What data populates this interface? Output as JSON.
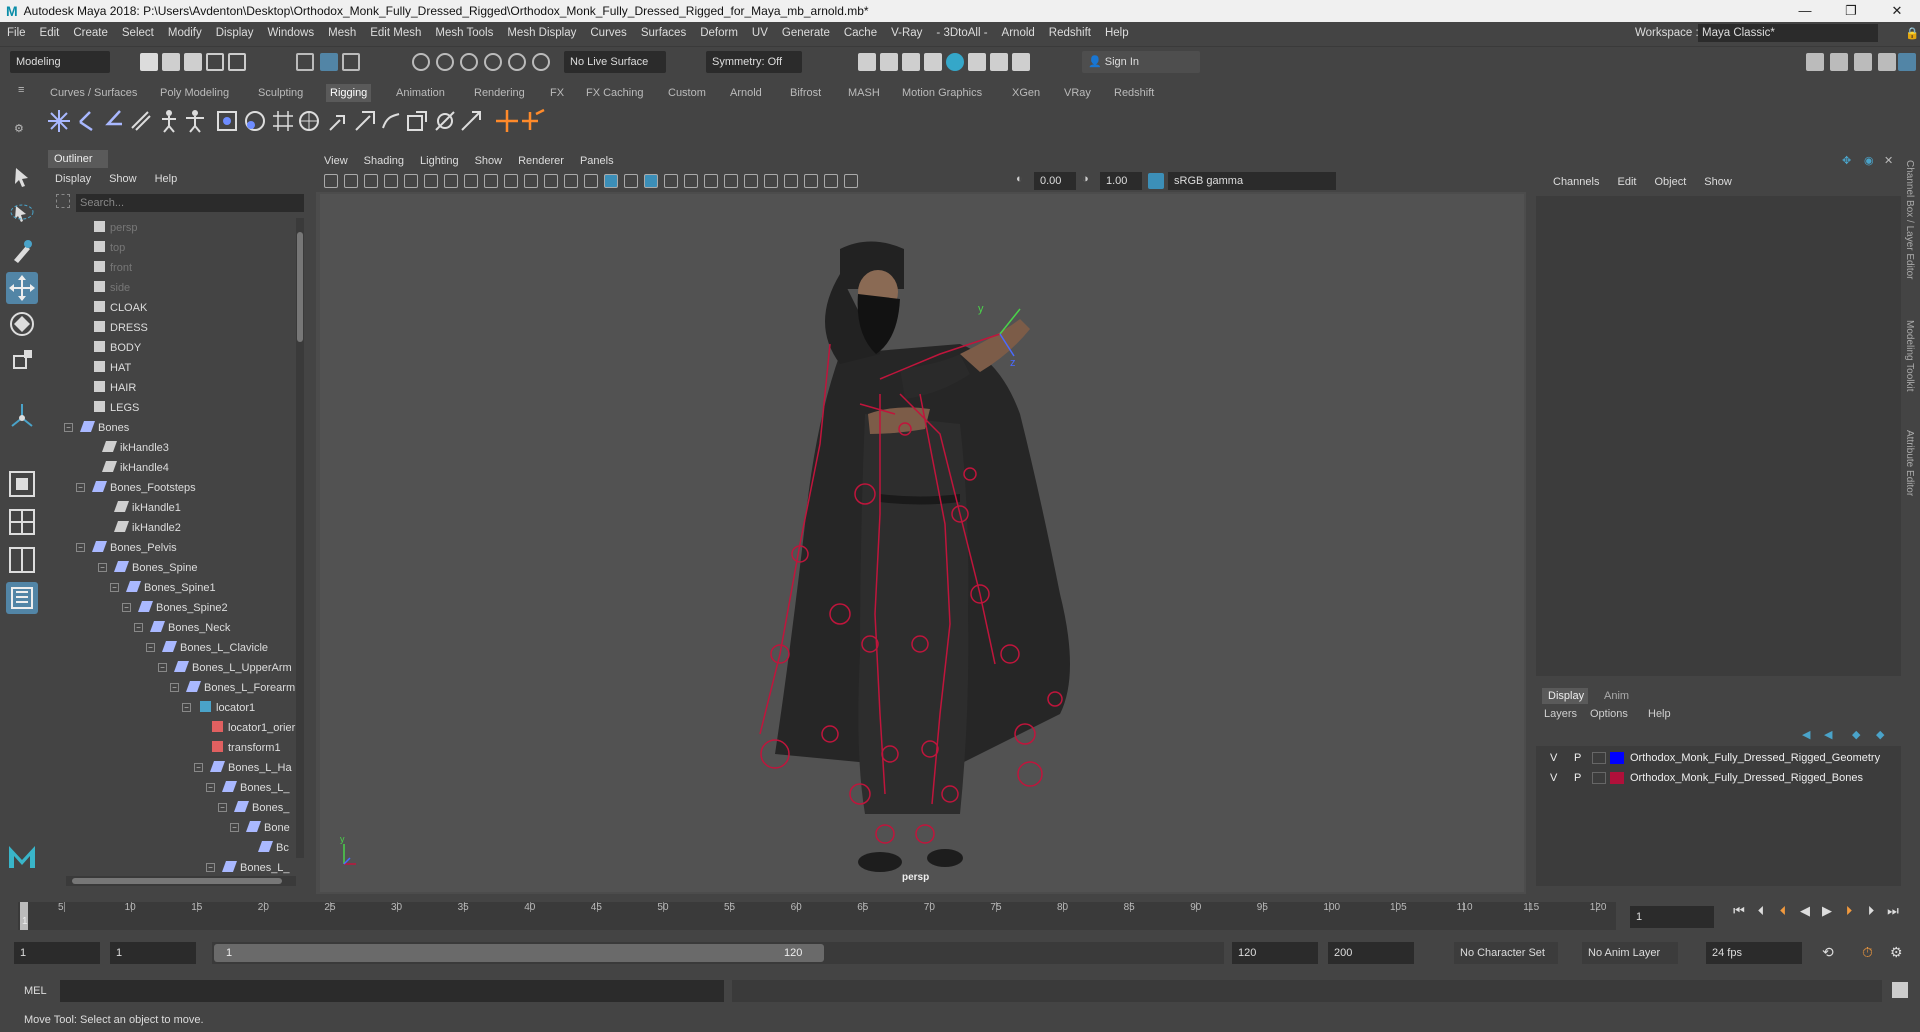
{
  "titlebar": {
    "title": "Autodesk Maya 2018: P:\\Users\\Avdenton\\Desktop\\Orthodox_Monk_Fully_Dressed_Rigged\\Orthodox_Monk_Fully_Dressed_Rigged_for_Maya_mb_arnold.mb*",
    "min": "—",
    "max": "❐",
    "close": "✕"
  },
  "menubar": [
    "File",
    "Edit",
    "Create",
    "Select",
    "Modify",
    "Display",
    "Windows",
    "Mesh",
    "Edit Mesh",
    "Mesh Tools",
    "Mesh Display",
    "Curves",
    "Surfaces",
    "Deform",
    "UV",
    "Generate",
    "Cache",
    "V-Ray",
    "- 3DtoAll -",
    "Arnold",
    "Redshift",
    "Help"
  ],
  "workspace": {
    "label": "Workspace :",
    "value": "Maya Classic*"
  },
  "statusline": {
    "mode": "Modeling",
    "live_surface": "No Live Surface",
    "symmetry": "Symmetry: Off",
    "sign_in": "Sign In"
  },
  "shelf_tabs": [
    "Curves / Surfaces",
    "Poly Modeling",
    "Sculpting",
    "Rigging",
    "Animation",
    "Rendering",
    "FX",
    "FX Caching",
    "Custom",
    "Arnold",
    "Bifrost",
    "MASH",
    "Motion Graphics",
    "XGen",
    "VRay",
    "Redshift"
  ],
  "shelf_active": "Rigging",
  "outliner": {
    "title": "Outliner",
    "menu": [
      "Display",
      "Show",
      "Help"
    ],
    "search_placeholder": "Search...",
    "rows": [
      {
        "label": "persp",
        "icon": "camera-icon",
        "dim": true
      },
      {
        "label": "top",
        "icon": "camera-icon",
        "dim": true
      },
      {
        "label": "front",
        "icon": "camera-icon",
        "dim": true
      },
      {
        "label": "side",
        "icon": "camera-icon",
        "dim": true
      },
      {
        "label": "CLOAK",
        "icon": "mesh-icon"
      },
      {
        "label": "DRESS",
        "icon": "mesh-icon"
      },
      {
        "label": "BODY",
        "icon": "mesh-icon"
      },
      {
        "label": "HAT",
        "icon": "mesh-icon"
      },
      {
        "label": "HAIR",
        "icon": "mesh-icon"
      },
      {
        "label": "LEGS",
        "icon": "mesh-icon"
      },
      {
        "label": "Bones",
        "icon": "joint-icon"
      },
      {
        "label": "ikHandle3",
        "icon": "ik-icon"
      },
      {
        "label": "ikHandle4",
        "icon": "ik-icon"
      },
      {
        "label": "Bones_Footsteps",
        "icon": "joint-icon"
      },
      {
        "label": "ikHandle1",
        "icon": "ik-icon"
      },
      {
        "label": "ikHandle2",
        "icon": "ik-icon"
      },
      {
        "label": "Bones_Pelvis",
        "icon": "joint-icon"
      },
      {
        "label": "Bones_Spine",
        "icon": "joint-icon"
      },
      {
        "label": "Bones_Spine1",
        "icon": "joint-icon"
      },
      {
        "label": "Bones_Spine2",
        "icon": "joint-icon"
      },
      {
        "label": "Bones_Neck",
        "icon": "joint-icon"
      },
      {
        "label": "Bones_L_Clavicle",
        "icon": "joint-icon"
      },
      {
        "label": "Bones_L_UpperArm",
        "icon": "joint-icon"
      },
      {
        "label": "Bones_L_Forearm",
        "icon": "joint-icon"
      },
      {
        "label": "locator1",
        "icon": "locator-icon"
      },
      {
        "label": "locator1_orier",
        "icon": "constraint-icon"
      },
      {
        "label": "transform1",
        "icon": "transform-icon"
      },
      {
        "label": "Bones_L_Ha",
        "icon": "joint-icon"
      },
      {
        "label": "Bones_L_",
        "icon": "joint-icon"
      },
      {
        "label": "Bones_",
        "icon": "joint-icon"
      },
      {
        "label": "Bone",
        "icon": "joint-icon"
      },
      {
        "label": "Bc",
        "icon": "joint-icon"
      },
      {
        "label": "Bones_L_",
        "icon": "joint-icon"
      }
    ]
  },
  "viewport": {
    "menu": [
      "View",
      "Shading",
      "Lighting",
      "Show",
      "Renderer",
      "Panels"
    ],
    "exposure": "0.00",
    "gamma": "1.00",
    "color_space": "sRGB gamma",
    "camera_label": "persp"
  },
  "channelbox": {
    "menu": [
      "Channels",
      "Edit",
      "Object",
      "Show"
    ],
    "layer_tabs": [
      "Display",
      "Anim"
    ],
    "layer_menu": [
      "Layers",
      "Options",
      "Help"
    ],
    "layers": [
      {
        "v": "V",
        "p": "P",
        "color": "#0000ff",
        "name": "Orthodox_Monk_Fully_Dressed_Rigged_Geometry"
      },
      {
        "v": "V",
        "p": "P",
        "color": "#b0103a",
        "name": "Orthodox_Monk_Fully_Dressed_Rigged_Bones"
      }
    ],
    "side_tabs": [
      "Channel Box / Layer Editor",
      "Modeling Toolkit",
      "Attribute Editor"
    ]
  },
  "timeline": {
    "ticks": [
      "5",
      "10",
      "15",
      "20",
      "25",
      "30",
      "35",
      "40",
      "45",
      "50",
      "55",
      "60",
      "65",
      "70",
      "75",
      "80",
      "85",
      "90",
      "95",
      "100",
      "105",
      "110",
      "115",
      "120"
    ],
    "start_tick": "1",
    "current_frame": "1"
  },
  "range": {
    "start": "1",
    "playback_start": "1",
    "slider_start": "1",
    "slider_end": "120",
    "playback_end": "120",
    "end": "200",
    "character_set": "No Character Set",
    "anim_layer": "No Anim Layer",
    "fps": "24 fps"
  },
  "cmdline": {
    "label": "MEL"
  },
  "helpline": "Move Tool: Select an object to move."
}
